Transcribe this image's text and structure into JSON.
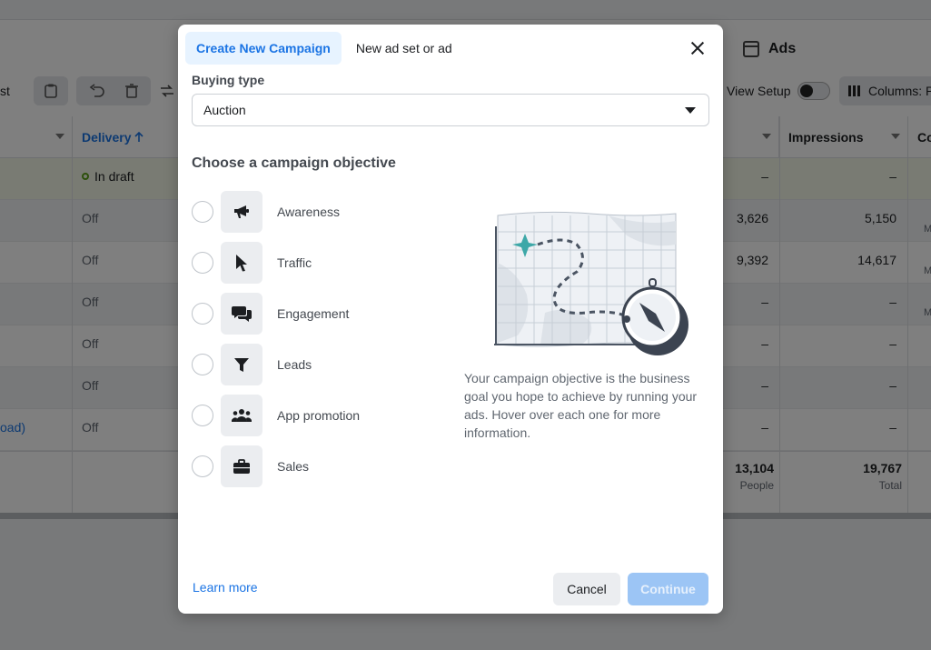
{
  "background": {
    "ads_tab_label": "Ads",
    "toolbar": {
      "left_text": "st",
      "view_setup_label": "View Setup",
      "columns_label": "Columns: P"
    },
    "table": {
      "headers": {
        "delivery": "Delivery",
        "impressions": "Impressions",
        "next": "Co"
      },
      "rows": [
        {
          "name": "",
          "delivery": "In draft",
          "reach": "–",
          "impressions": "–",
          "extra": ""
        },
        {
          "name": "",
          "delivery": "Off",
          "reach": "3,626",
          "impressions": "5,150",
          "extra": "M"
        },
        {
          "name": "",
          "delivery": "Off",
          "reach": "9,392",
          "impressions": "14,617",
          "extra": "M"
        },
        {
          "name": "",
          "delivery": "Off",
          "reach": "–",
          "impressions": "–",
          "extra": "M"
        },
        {
          "name": "",
          "delivery": "Off",
          "reach": "–",
          "impressions": "–",
          "extra": ""
        },
        {
          "name": "",
          "delivery": "Off",
          "reach": "–",
          "impressions": "–",
          "extra": ""
        },
        {
          "name": "oad)",
          "delivery": "Off",
          "reach": "–",
          "impressions": "–",
          "extra": ""
        }
      ],
      "totals": {
        "reach_value": "13,104",
        "reach_unit": "People",
        "impressions_value": "19,767",
        "impressions_unit": "Total"
      }
    }
  },
  "modal": {
    "tabs": [
      {
        "label": "Create New Campaign",
        "active": true
      },
      {
        "label": "New ad set or ad",
        "active": false
      }
    ],
    "buying_type_label": "Buying type",
    "buying_type_value": "Auction",
    "objective_title": "Choose a campaign objective",
    "objectives": [
      {
        "label": "Awareness",
        "icon": "megaphone-icon"
      },
      {
        "label": "Traffic",
        "icon": "cursor-icon"
      },
      {
        "label": "Engagement",
        "icon": "chat-bubbles-icon"
      },
      {
        "label": "Leads",
        "icon": "filter-icon"
      },
      {
        "label": "App promotion",
        "icon": "people-icon"
      },
      {
        "label": "Sales",
        "icon": "shopping-bag-icon"
      }
    ],
    "description": "Your campaign objective is the business goal you hope to achieve by running your ads. Hover over each one for more information.",
    "learn_more": "Learn more",
    "cancel_label": "Cancel",
    "continue_label": "Continue",
    "colors": {
      "accent": "#1b74e4",
      "continue_disabled": "#9cc5f5",
      "teal_star": "#3ea8a8"
    }
  }
}
